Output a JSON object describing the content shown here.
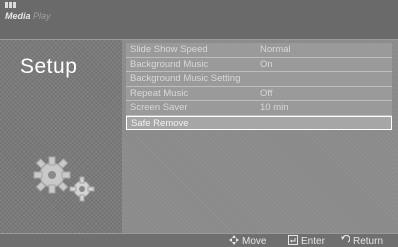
{
  "header": {
    "brand": "Media",
    "brand_suffix": "Play"
  },
  "sidebar": {
    "title": "Setup",
    "icon": "gear-icon"
  },
  "menu": {
    "items": [
      {
        "label": "Slide Show Speed",
        "value": "Normal"
      },
      {
        "label": "Background Music",
        "value": "On"
      },
      {
        "label": "Background Music Setting",
        "value": ""
      },
      {
        "label": "Repeat Music",
        "value": "Off"
      },
      {
        "label": "Screen Saver",
        "value": "10 min"
      },
      {
        "label": "Safe Remove",
        "value": ""
      }
    ],
    "selected_index": 5
  },
  "footer": {
    "move_label": "Move",
    "move_icon": "dpad-icon",
    "enter_label": "Enter",
    "enter_icon": "enter-icon",
    "return_label": "Return",
    "return_icon": "return-icon"
  }
}
